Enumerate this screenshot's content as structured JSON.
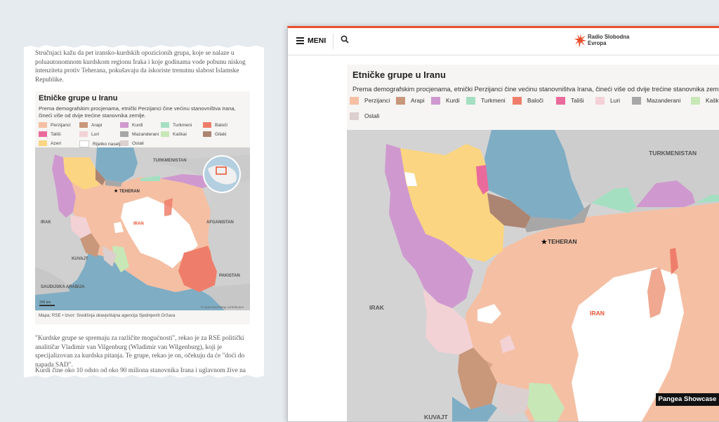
{
  "article": {
    "intro": "Stručnjaci kažu da pet iransko-kurdskih opozicionih grupa, koje se nalaze u poluautonomnom kurdskom regionu Iraka i koje godinama vode pobunu niskog intenziteta protiv Teherana, pokušavaju da iskoriste trenutnu slabost Islamske Republike.",
    "quote": "\"Kurdske grupe se spremaju za različite mogućnosti\", rekao je za RSE politički analitičar Vladimir van Vilgenburg (Wladimir van Wilgenburg), koji je specijalizovan za kurdska pitanja. Te grupe, rekao je on, očekuju da će \"doći do napada SAD\".",
    "continuation": "Kurdi čine oko 10 odsto od oko 90 miliona stanovnika Irana i uglavnom žive na zapadu"
  },
  "infographic": {
    "title": "Etničke grupe u Iranu",
    "subtitle": "Prema demografskim procjenama, etnički Perzijanci čine većinu stanovništva Irana, čineći više od dvije trećine stanovnika zemlje.",
    "caption": "Mapa: RSE • Izvor: Središnja obavještajna agencija Sjedinjenih Država",
    "scale": "200 km",
    "attribution": "© OpenStreetMap contributors",
    "legend": [
      {
        "label": "Perzijanci",
        "color": "#f5bfa3"
      },
      {
        "label": "Arapi",
        "color": "#c9977a"
      },
      {
        "label": "Kurdi",
        "color": "#cf99cf"
      },
      {
        "label": "Turkmeni",
        "color": "#a5dfc2"
      },
      {
        "label": "Baloči",
        "color": "#ee7e6b"
      },
      {
        "label": "Tališi",
        "color": "#ea6a9b"
      },
      {
        "label": "Luri",
        "color": "#f2d2d5"
      },
      {
        "label": "Mazanderani",
        "color": "#a7a7a8"
      },
      {
        "label": "Kaškai",
        "color": "#c8e7b7"
      },
      {
        "label": "Gilaki",
        "color": "#ac8472"
      },
      {
        "label": "Azeri",
        "color": "#fbd581"
      },
      {
        "label": "Rijetko naseljeno",
        "color": "#ffffff"
      },
      {
        "label": "Ostali",
        "color": "#dccfcf"
      }
    ],
    "map_labels": {
      "turkmenistan": "TURKMENISTAN",
      "teheran": "TEHERAN",
      "iraq": "IRAK",
      "iran": "IRAN",
      "afghanistan": "AFGANISTAN",
      "kuwait": "KUVAJT",
      "pakistan": "PAKISTAN",
      "saudi": "SAUDIJSKA ARABIJA"
    }
  },
  "site": {
    "menu_label": "MENI",
    "logo_line1": "Radio Slobodna",
    "logo_line2": "Evropa",
    "logo_color": "#e8502d"
  },
  "badge": "Pangea Showcase"
}
